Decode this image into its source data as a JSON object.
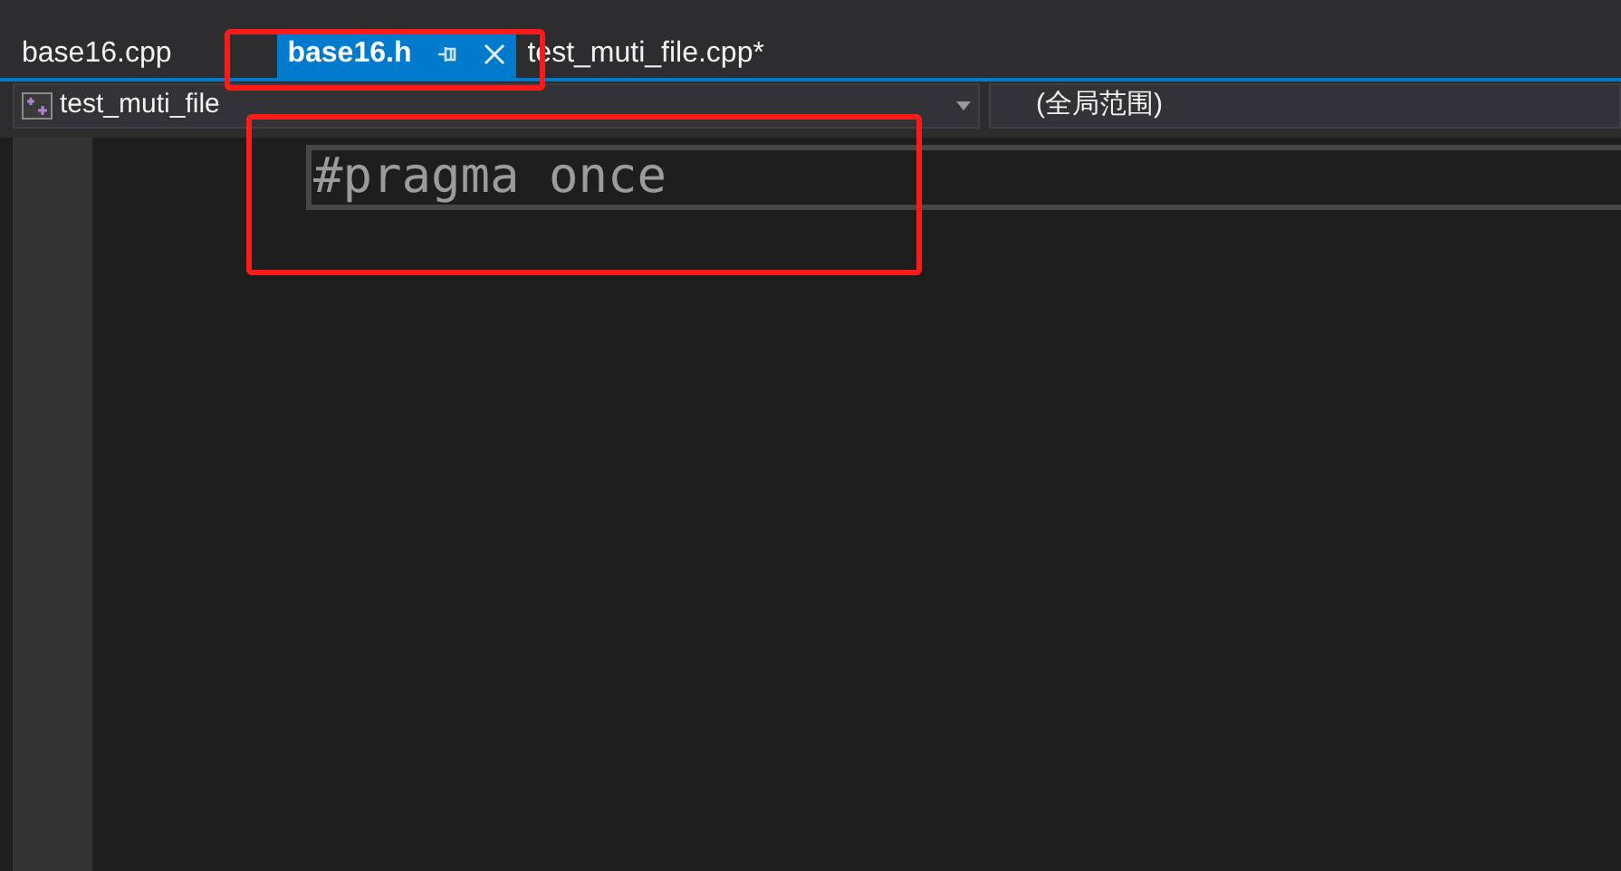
{
  "tabs": [
    {
      "label": "base16.cpp",
      "selected": false,
      "pinned": false
    },
    {
      "label": "base16.h",
      "selected": true,
      "pinned": true
    },
    {
      "label": "test_muti_file.cpp*",
      "selected": false,
      "pinned": false
    }
  ],
  "navigation_bar": {
    "project": "test_muti_file",
    "scope": "(全局范围)"
  },
  "editor": {
    "lines": [
      "#pragma once"
    ]
  },
  "annotations": [
    {
      "kind": "highlight"
    },
    {
      "kind": "highlight"
    }
  ]
}
